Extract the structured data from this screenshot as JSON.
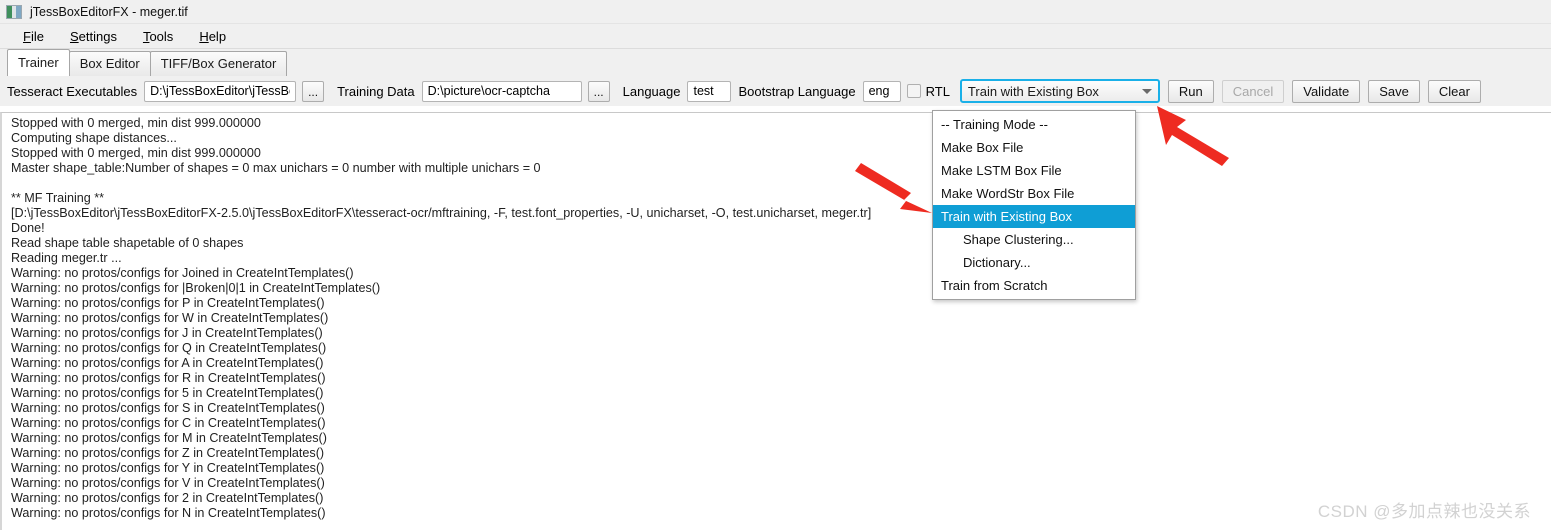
{
  "window": {
    "title": "jTessBoxEditorFX - meger.tif",
    "icon": "image-file-icon"
  },
  "menubar": {
    "items": [
      {
        "label": "File",
        "mnemonic": "F"
      },
      {
        "label": "Settings",
        "mnemonic": "S"
      },
      {
        "label": "Tools",
        "mnemonic": "T"
      },
      {
        "label": "Help",
        "mnemonic": "H"
      }
    ]
  },
  "tabs": [
    {
      "label": "Trainer",
      "active": true
    },
    {
      "label": "Box Editor",
      "active": false
    },
    {
      "label": "TIFF/Box Generator",
      "active": false
    }
  ],
  "toolbar": {
    "tesseract_executables_label": "Tesseract Executables",
    "tesseract_executables_value": "D:\\jTessBoxEditor\\jTessBc",
    "browse_exec_label": "...",
    "training_data_label": "Training Data",
    "training_data_value": "D:\\picture\\ocr-captcha",
    "browse_data_label": "...",
    "language_label": "Language",
    "language_value": "test",
    "bootstrap_language_label": "Bootstrap Language",
    "bootstrap_language_value": "eng",
    "rtl_label": "RTL",
    "rtl_checked": false,
    "training_mode_selected": "Train with Existing Box",
    "run_label": "Run",
    "cancel_label": "Cancel",
    "cancel_disabled": true,
    "validate_label": "Validate",
    "save_label": "Save",
    "clear_label": "Clear"
  },
  "dropdown": {
    "open": true,
    "items": [
      {
        "label": "-- Training Mode --",
        "indent": false,
        "selected": false
      },
      {
        "label": "Make Box File",
        "indent": false,
        "selected": false
      },
      {
        "label": "Make LSTM Box File",
        "indent": false,
        "selected": false
      },
      {
        "label": "Make WordStr Box File",
        "indent": false,
        "selected": false
      },
      {
        "label": "Train with Existing Box",
        "indent": false,
        "selected": true
      },
      {
        "label": "Shape Clustering...",
        "indent": true,
        "selected": false
      },
      {
        "label": "Dictionary...",
        "indent": true,
        "selected": false
      },
      {
        "label": "Train from Scratch",
        "indent": false,
        "selected": false
      }
    ]
  },
  "console": {
    "lines": [
      "Stopped with 0 merged, min dist 999.000000",
      "Computing shape distances...",
      "Stopped with 0 merged, min dist 999.000000",
      "Master shape_table:Number of shapes = 0 max unichars = 0 number with multiple unichars = 0",
      "",
      "** MF Training **",
      "[D:\\jTessBoxEditor\\jTessBoxEditorFX-2.5.0\\jTessBoxEditorFX\\tesseract-ocr/mftraining, -F, test.font_properties, -U, unicharset, -O, test.unicharset, meger.tr]",
      "Done!",
      "Read shape table shapetable of 0 shapes",
      "Reading meger.tr ...",
      "Warning: no protos/configs for Joined in CreateIntTemplates()",
      "Warning: no protos/configs for |Broken|0|1 in CreateIntTemplates()",
      "Warning: no protos/configs for P in CreateIntTemplates()",
      "Warning: no protos/configs for W in CreateIntTemplates()",
      "Warning: no protos/configs for J in CreateIntTemplates()",
      "Warning: no protos/configs for Q in CreateIntTemplates()",
      "Warning: no protos/configs for A in CreateIntTemplates()",
      "Warning: no protos/configs for R in CreateIntTemplates()",
      "Warning: no protos/configs for 5 in CreateIntTemplates()",
      "Warning: no protos/configs for S in CreateIntTemplates()",
      "Warning: no protos/configs for C in CreateIntTemplates()",
      "Warning: no protos/configs for M in CreateIntTemplates()",
      "Warning: no protos/configs for Z in CreateIntTemplates()",
      "Warning: no protos/configs for Y in CreateIntTemplates()",
      "Warning: no protos/configs for V in CreateIntTemplates()",
      "Warning: no protos/configs for 2 in CreateIntTemplates()",
      "Warning: no protos/configs for N in CreateIntTemplates()"
    ]
  },
  "annotations": {
    "arrow_color": "#ee2b21",
    "arrow_run_target": "Run",
    "arrow_menu_target": "Train with Existing Box"
  },
  "watermark": {
    "text": "CSDN @多加点辣也没关系"
  },
  "colors": {
    "accent_selection": "#0f9ed5",
    "combo_focus_border": "#1ab0e8",
    "window_chrome": "#f0f0f0"
  }
}
